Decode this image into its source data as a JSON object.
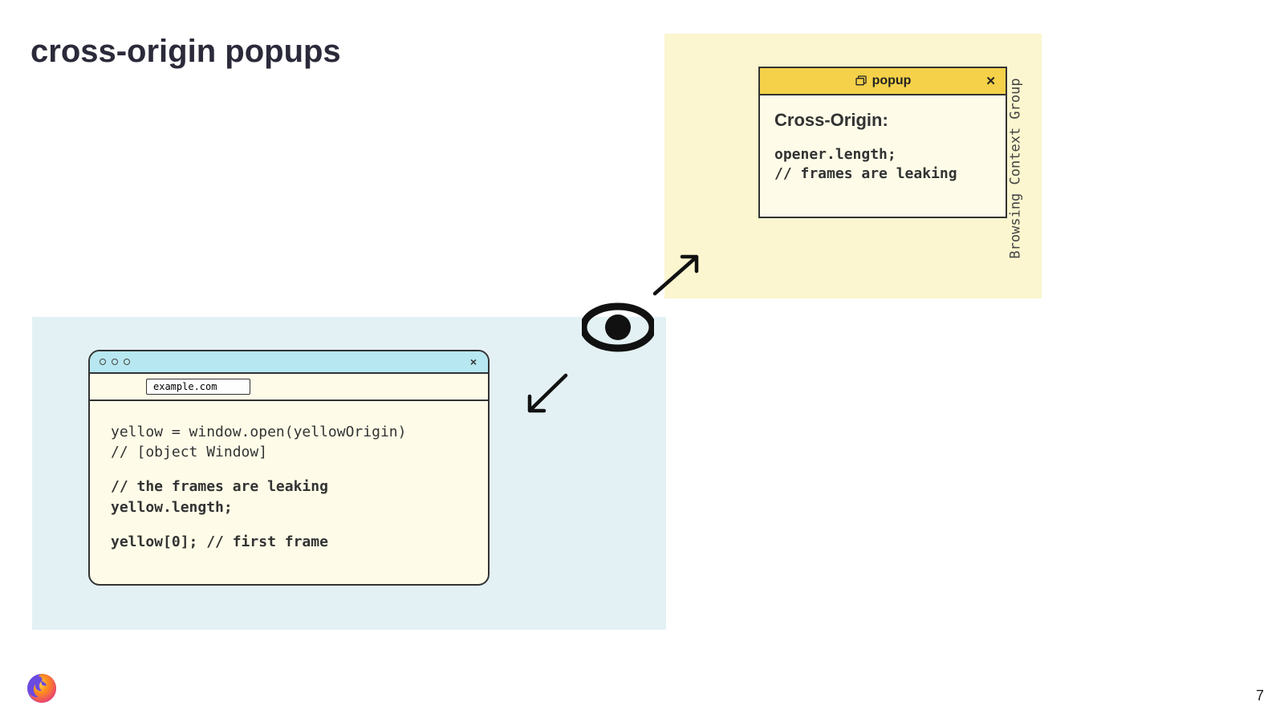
{
  "title": "cross-origin popups",
  "browser": {
    "url": "example.com",
    "code": {
      "l1": "yellow = window.open(yellowOrigin)",
      "l2": "// [object Window]",
      "l3": "// the frames are leaking",
      "l4": "yellow.length;",
      "l5": "yellow[0]; // first frame"
    }
  },
  "popup": {
    "tab_label": "popup",
    "heading": "Cross-Origin:",
    "code": {
      "l1": "opener.length;",
      "l2": "// frames are leaking"
    }
  },
  "region_label": "Browsing Context Group",
  "page_number": "7"
}
